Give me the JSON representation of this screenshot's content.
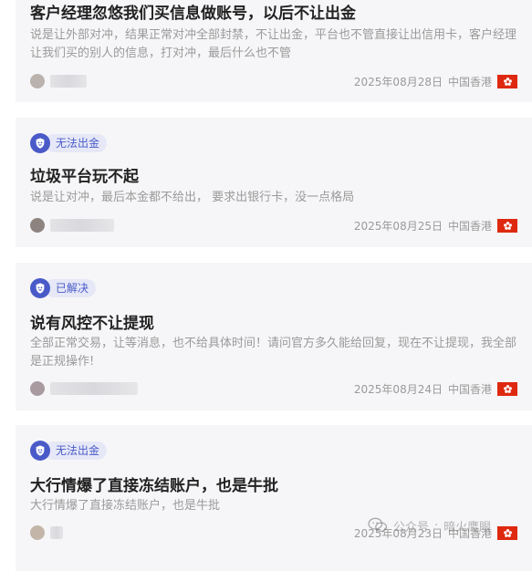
{
  "feed": {
    "cards": [
      {
        "status_tag": "",
        "title": "客户经理忽悠我们买信息做账号，以后不让出金",
        "description": "说是让外部对冲，结果正常对冲全部封禁，不让出金，平台也不管直接让出信用卡，客户经理让我们买的别人的信息，打对冲，最后什么也不管",
        "date": "2025年08月28日",
        "region": "中国香港"
      },
      {
        "status_tag": "无法出金",
        "title": "垃圾平台玩不起",
        "description": "说是让对冲，最后本金都不给出， 要求出银行卡，没一点格局",
        "date": "2025年08月25日",
        "region": "中国香港"
      },
      {
        "status_tag": "已解决",
        "title": "说有风控不让提现",
        "description": "全部正常交易，让等消息，也不给具体时间！请问官方多久能给回复，现在不让提现，我全部是正规操作!",
        "date": "2025年08月24日",
        "region": "中国香港"
      },
      {
        "status_tag": "无法出金",
        "title": "大行情爆了直接冻结账户，也是牛批",
        "description": "大行情爆了直接冻结账户，也是牛批",
        "date": "2025年08月23日",
        "region": "中国香港"
      }
    ]
  },
  "watermark": {
    "prefix": "公众号",
    "separator": "·",
    "name": "暗火鹰眼"
  },
  "colors": {
    "tag_accent": "#4a5bc8",
    "tag_bg": "#e6e8f7",
    "flag_red": "#de2910",
    "card_bg": "#f6f6f8",
    "title": "#222222",
    "muted": "#9a9a9a"
  },
  "icons": {
    "tag": "shield-badge-icon",
    "flag": "hong-kong-flag-icon",
    "watermark": "wechat-icon"
  }
}
